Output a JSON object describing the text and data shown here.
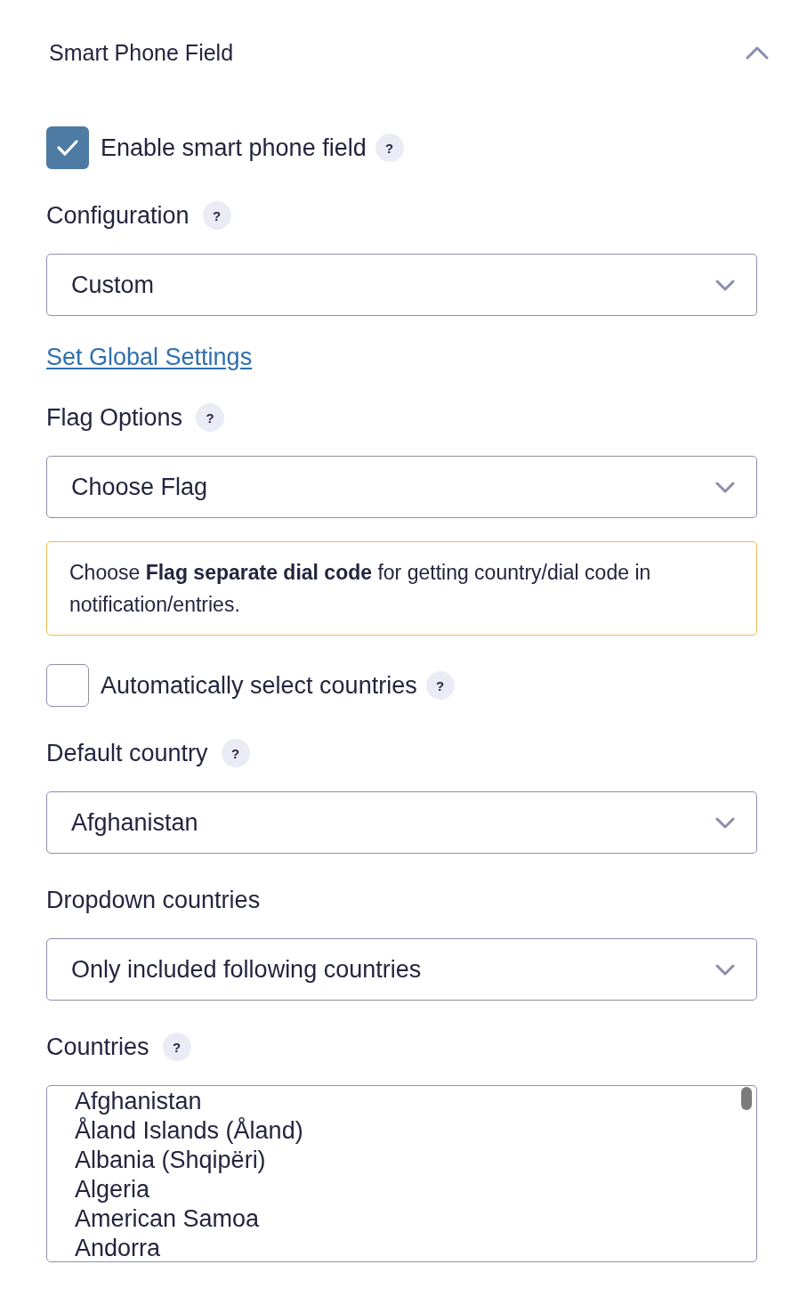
{
  "section": {
    "title": "Smart Phone Field",
    "expanded": true
  },
  "fields": [
    {
      "kind": "checkbox",
      "label": "Enable smart phone field",
      "checked": true,
      "help": "?"
    },
    {
      "kind": "select",
      "label": "Configuration",
      "help": "?",
      "value": "Custom"
    },
    {
      "kind": "link",
      "text": "Set Global Settings"
    },
    {
      "kind": "select",
      "label": "Flag Options",
      "help": "?",
      "value": "Choose Flag"
    },
    {
      "kind": "notice",
      "text": "Choose **Flag separate dial code** for getting country/dial code in notification/entries."
    },
    {
      "kind": "checkbox",
      "label": "Automatically select countries",
      "checked": false,
      "help": "?"
    },
    {
      "kind": "select",
      "label": "Default country",
      "help": "?",
      "value": "Afghanistan"
    },
    {
      "kind": "select",
      "label": "Dropdown countries",
      "value": "Only included following countries"
    },
    {
      "kind": "listbox",
      "label": "Countries",
      "help": "?",
      "options": [
        "Afghanistan",
        "Åland Islands (Åland)",
        "Albania (Shqipëri)",
        "Algeria",
        "American Samoa",
        "Andorra"
      ]
    }
  ]
}
